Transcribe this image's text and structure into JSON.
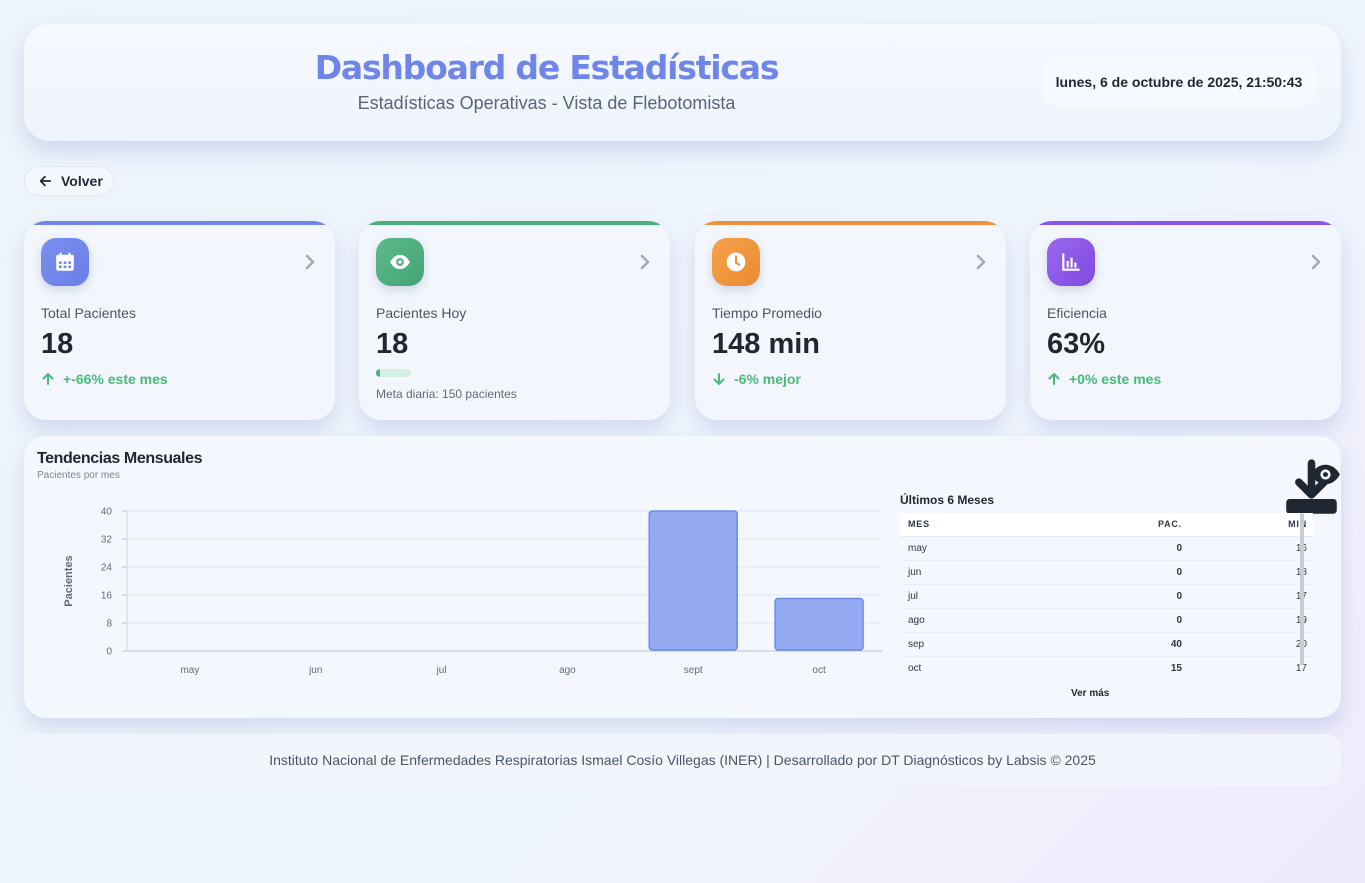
{
  "header": {
    "title": "Dashboard de Estadísticas",
    "subtitle": "Estadísticas Operativas - Vista de Flebotomista",
    "datetime": "lunes, 6 de octubre de 2025, 21:50:43"
  },
  "back_button": {
    "label": "Volver",
    "icon": "arrow-left-icon"
  },
  "cards": [
    {
      "label": "Total Pacientes",
      "value": "18",
      "trend": "+-66% este mes",
      "trend_direction": "up",
      "icon": "calendar-icon",
      "color": "#6f86e8",
      "accent": "#6f86e8"
    },
    {
      "label": "Pacientes Hoy",
      "value": "18",
      "progress_fraction": 0.12,
      "meta": "Meta diaria: 150 pacientes",
      "icon": "eye-icon",
      "color": "#4caf7d",
      "accent": "#4caf7d"
    },
    {
      "label": "Tiempo Promedio",
      "value": "148 min",
      "trend": "-6% mejor",
      "trend_direction": "down",
      "icon": "clock-icon",
      "color": "#f0923a",
      "accent": "#f0923a"
    },
    {
      "label": "Eficiencia",
      "value": "63%",
      "trend": "+0% este mes",
      "trend_direction": "up",
      "icon": "bar-chart-icon",
      "color": "#8a55e8",
      "accent": "#8a55e8"
    }
  ],
  "trends": {
    "title": "Tendencias Mensuales",
    "subtitle": "Pacientes por mes",
    "actions": [
      "download-icon",
      "eye-icon"
    ]
  },
  "chart_data": {
    "type": "bar",
    "categories": [
      "may",
      "jun",
      "jul",
      "ago",
      "sept",
      "oct"
    ],
    "values": [
      0,
      0,
      0,
      0,
      40,
      15
    ],
    "ylabel": "Pacientes",
    "ylim": [
      0,
      40
    ],
    "yticks": [
      "40",
      "32",
      "24",
      "16",
      "8",
      "0"
    ],
    "grid": true,
    "bar_color": "#93a9f1"
  },
  "table": {
    "title": "Últimos 6 Meses",
    "columns": [
      "MES",
      "PAC.",
      "MIN"
    ],
    "rows": [
      [
        "may",
        "0",
        "16"
      ],
      [
        "jun",
        "0",
        "18"
      ],
      [
        "jul",
        "0",
        "17"
      ],
      [
        "ago",
        "0",
        "19"
      ],
      [
        "sep",
        "40",
        "20"
      ],
      [
        "oct",
        "15",
        "17"
      ]
    ],
    "more_label": "Ver más"
  },
  "footer": {
    "text": "Instituto Nacional de Enfermedades Respiratorias Ismael Cosío Villegas (INER) | Desarrollado por DT Diagnósticos by Labsis © 2025"
  }
}
